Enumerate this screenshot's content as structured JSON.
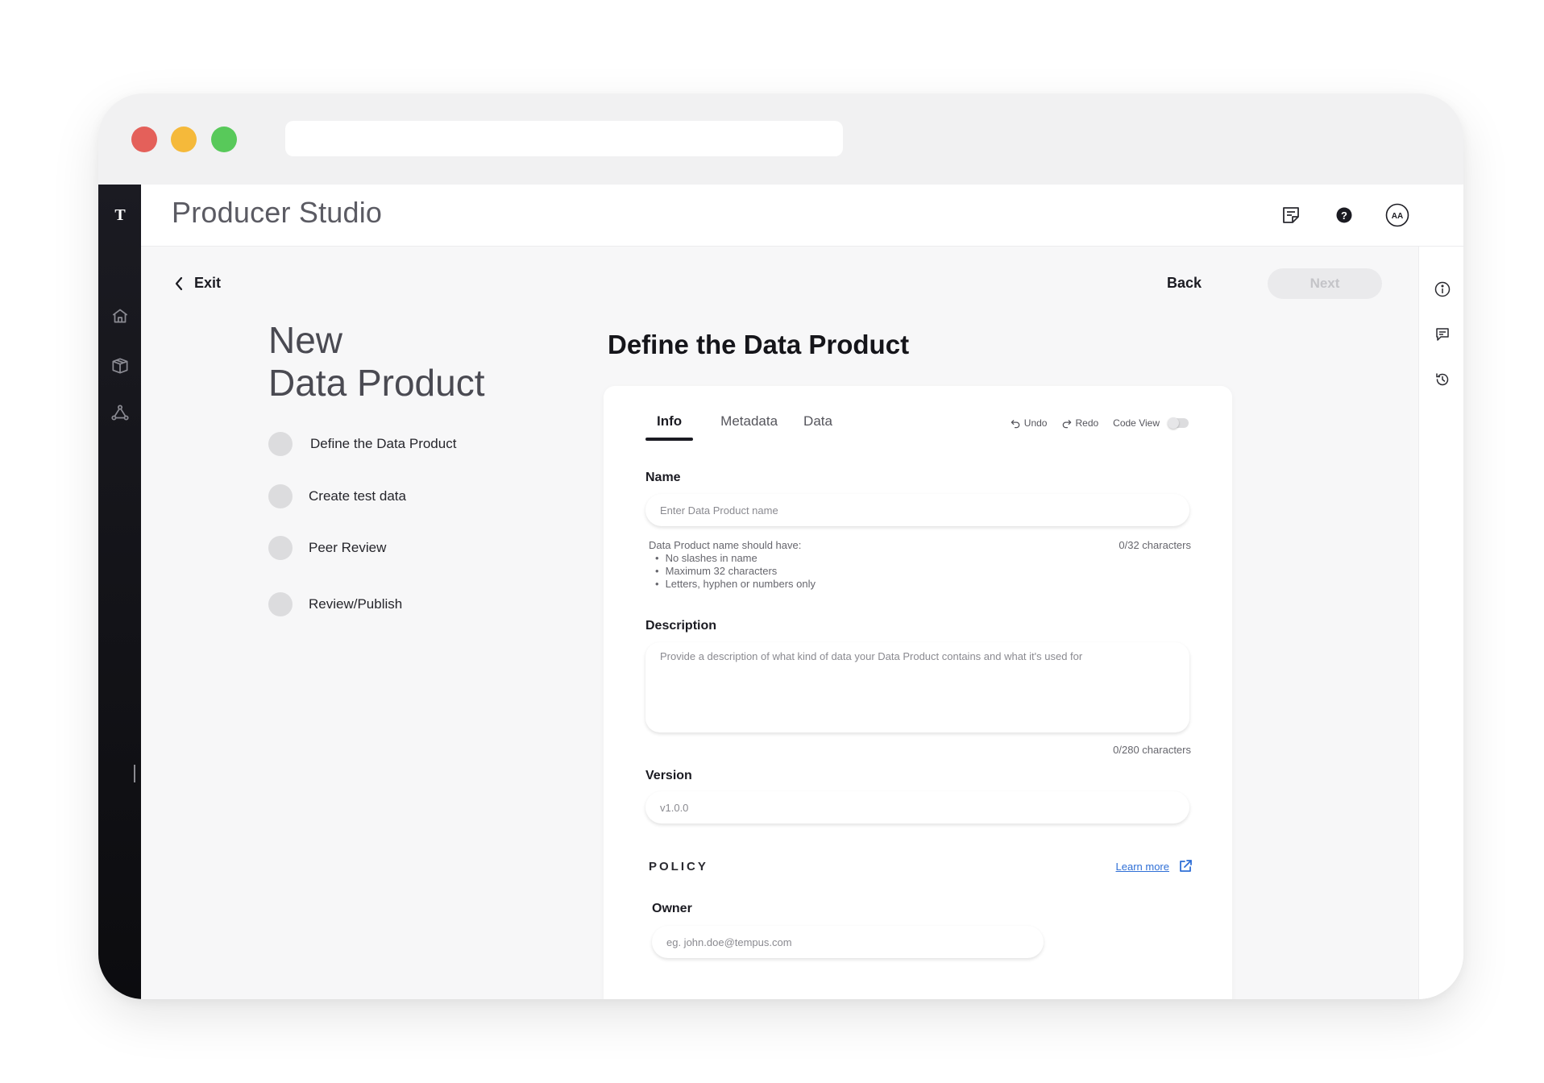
{
  "app": {
    "title": "Producer Studio",
    "logo": "T"
  },
  "header": {
    "avatar_initials": "AA",
    "icons": [
      "notes-icon",
      "help-icon",
      "avatar"
    ]
  },
  "leftnav": {
    "icons": [
      "home-icon",
      "package-icon",
      "network-icon"
    ]
  },
  "rightrail": {
    "icons": [
      "info-icon",
      "comment-icon",
      "history-icon"
    ]
  },
  "nav": {
    "exit_label": "Exit",
    "back_label": "Back",
    "next_label": "Next"
  },
  "wizard": {
    "title_line1": "New",
    "title_line2": "Data Product",
    "steps": [
      {
        "label": "Define the Data Product"
      },
      {
        "label": "Create test data"
      },
      {
        "label": "Peer Review"
      },
      {
        "label": "Review/Publish"
      }
    ]
  },
  "page": {
    "title": "Define the Data Product"
  },
  "tabs": [
    {
      "label": "Info",
      "active": true
    },
    {
      "label": "Metadata",
      "active": false
    },
    {
      "label": "Data",
      "active": false
    }
  ],
  "tools": {
    "undo_label": "Undo",
    "redo_label": "Redo",
    "code_view_label": "Code View",
    "code_view_on": false
  },
  "form": {
    "name": {
      "label": "Name",
      "placeholder": "Enter Data Product name",
      "value": "",
      "hint_title": "Data Product name should have:",
      "rules": [
        "No slashes in name",
        "Maximum 32 characters",
        "Letters, hyphen or numbers only"
      ],
      "counter": "0/32 characters"
    },
    "description": {
      "label": "Description",
      "placeholder": "Provide a description of what kind of data your Data Product contains and what it's used for",
      "value": "",
      "counter": "0/280 characters"
    },
    "version": {
      "label": "Version",
      "placeholder": "v1.0.0",
      "value": ""
    },
    "policy": {
      "heading": "POLICY",
      "learn_more_label": "Learn more"
    },
    "owner": {
      "label": "Owner",
      "placeholder": "eg. john.doe@tempus.com",
      "value": ""
    }
  },
  "colors": {
    "sidebar": "#1b1b22",
    "link": "#2f6fd6",
    "next_disabled_bg": "#eaeaec",
    "traffic_red": "#e4605a",
    "traffic_yellow": "#f5b93a",
    "traffic_green": "#58c95a"
  }
}
